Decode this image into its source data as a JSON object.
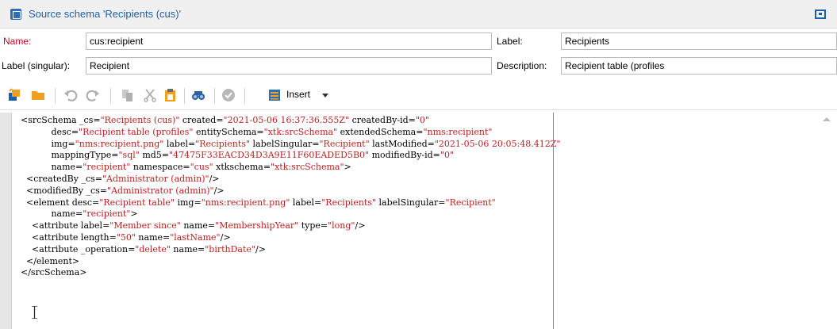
{
  "window": {
    "title": "Source schema 'Recipients (cus)'"
  },
  "form": {
    "name_label": "Name:",
    "name_value": "cus:recipient",
    "label_label": "Label:",
    "label_value": "Recipients",
    "singular_label": "Label (singular):",
    "singular_value": "Recipient",
    "description_label": "Description:",
    "description_value": "Recipient table (profiles"
  },
  "toolbar": {
    "insert_label": "Insert"
  },
  "code_lines": [
    [
      [
        "<srcSchema _cs=",
        "t"
      ],
      [
        "\"Recipients (cus)\"",
        "v"
      ],
      [
        " created=",
        "t"
      ],
      [
        "\"2021-05-06 16:37:36.555Z\"",
        "v"
      ],
      [
        " createdBy-id=",
        "t"
      ],
      [
        "\"0\"",
        "v"
      ]
    ],
    [
      [
        "           desc=",
        "t"
      ],
      [
        "\"Recipient table (profiles\"",
        "v"
      ],
      [
        " entitySchema=",
        "t"
      ],
      [
        "\"xtk:srcSchema\"",
        "v"
      ],
      [
        " extendedSchema=",
        "t"
      ],
      [
        "\"nms:recipient\"",
        "v"
      ]
    ],
    [
      [
        "           img=",
        "t"
      ],
      [
        "\"nms:recipient.png\"",
        "v"
      ],
      [
        " label=",
        "t"
      ],
      [
        "\"Recipients\"",
        "v"
      ],
      [
        " labelSingular=",
        "t"
      ],
      [
        "\"Recipient\"",
        "v"
      ],
      [
        " lastModified=",
        "t"
      ],
      [
        "\"2021-05-06 20:05:48.412Z\"",
        "v"
      ]
    ],
    [
      [
        "           mappingType=",
        "t"
      ],
      [
        "\"sql\"",
        "v"
      ],
      [
        " md5=",
        "t"
      ],
      [
        "\"47475F33EACD34D3A9E11F60EADED5B0\"",
        "v"
      ],
      [
        " modifiedBy-id=",
        "t"
      ],
      [
        "\"0\"",
        "v"
      ]
    ],
    [
      [
        "           name=",
        "t"
      ],
      [
        "\"recipient\"",
        "v"
      ],
      [
        " namespace=",
        "t"
      ],
      [
        "\"cus\"",
        "v"
      ],
      [
        " xtkschema=",
        "t"
      ],
      [
        "\"xtk:srcSchema\"",
        "v"
      ],
      [
        ">",
        "t"
      ]
    ],
    [
      [
        "  <createdBy _cs=",
        "t"
      ],
      [
        "\"Administrator (admin)\"",
        "v"
      ],
      [
        "/>",
        "t"
      ]
    ],
    [
      [
        "  <modifiedBy _cs=",
        "t"
      ],
      [
        "\"Administrator (admin)\"",
        "v"
      ],
      [
        "/>",
        "t"
      ]
    ],
    [
      [
        "  <element desc=",
        "t"
      ],
      [
        "\"Recipient table\"",
        "v"
      ],
      [
        " img=",
        "t"
      ],
      [
        "\"nms:recipient.png\"",
        "v"
      ],
      [
        " label=",
        "t"
      ],
      [
        "\"Recipients\"",
        "v"
      ],
      [
        " labelSingular=",
        "t"
      ],
      [
        "\"Recipient\"",
        "v"
      ]
    ],
    [
      [
        "           name=",
        "t"
      ],
      [
        "\"recipient\"",
        "v"
      ],
      [
        ">",
        "t"
      ]
    ],
    [
      [
        "    <attribute label=",
        "t"
      ],
      [
        "\"Member since\"",
        "v"
      ],
      [
        " name=",
        "t"
      ],
      [
        "\"MembershipYear\"",
        "v"
      ],
      [
        " type=",
        "t"
      ],
      [
        "\"long\"",
        "v"
      ],
      [
        "/>",
        "t"
      ]
    ],
    [
      [
        "    <attribute length=",
        "t"
      ],
      [
        "\"50\"",
        "v"
      ],
      [
        " name=",
        "t"
      ],
      [
        "\"lastName\"",
        "v"
      ],
      [
        "/>",
        "t"
      ]
    ],
    [
      [
        "    <attribute _operation=",
        "t"
      ],
      [
        "\"delete\"",
        "v"
      ],
      [
        " name=",
        "t"
      ],
      [
        "\"birthDate\"",
        "v"
      ],
      [
        "/>",
        "t"
      ]
    ],
    [
      [
        "  </element>",
        "t"
      ]
    ],
    [
      [
        "</srcSchema>",
        "t"
      ]
    ]
  ],
  "colors": {
    "accent": "#1f5fa8",
    "required": "#d0021b",
    "xml_value": "#c02020"
  },
  "icons": [
    "schema-icon",
    "maximize-icon",
    "new-icon",
    "folder-icon",
    "undo-icon",
    "redo-icon",
    "copy-icon",
    "cut-icon",
    "paste-icon",
    "find-icon",
    "validate-icon",
    "insert-icon",
    "dropdown-arrow-icon"
  ]
}
